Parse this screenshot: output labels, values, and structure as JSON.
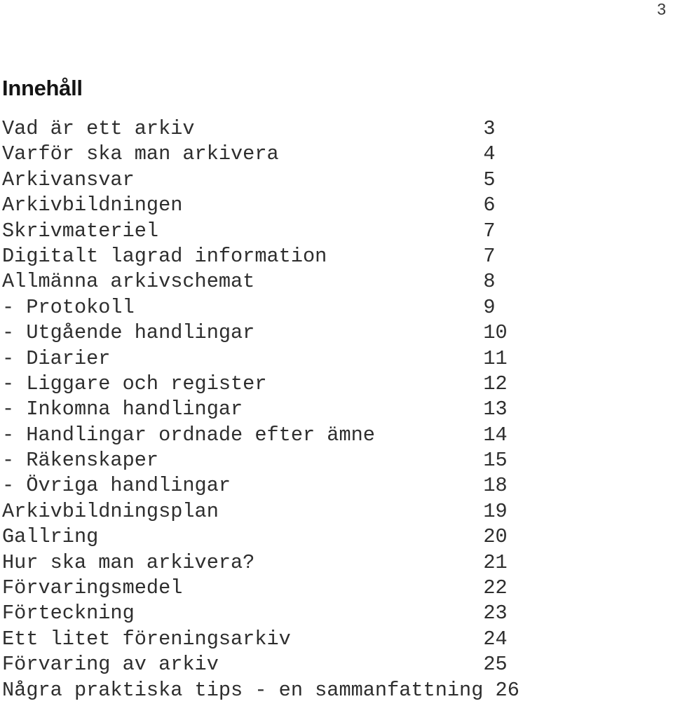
{
  "folio": {
    "page_number": "3"
  },
  "heading": {
    "title": "Innehåll"
  },
  "toc": {
    "column_width_chars": 40,
    "entries": [
      {
        "label": "Vad är ett arkiv",
        "page": "3"
      },
      {
        "label": "Varför ska man arkivera",
        "page": "4"
      },
      {
        "label": "Arkivansvar",
        "page": "5"
      },
      {
        "label": "Arkivbildningen",
        "page": "6"
      },
      {
        "label": "Skrivmateriel",
        "page": "7"
      },
      {
        "label": "Digitalt lagrad information",
        "page": "7"
      },
      {
        "label": "Allmänna arkivschemat",
        "page": "8"
      },
      {
        "label": "- Protokoll",
        "page": "9"
      },
      {
        "label": "- Utgående handlingar",
        "page": "10"
      },
      {
        "label": "- Diarier",
        "page": "11"
      },
      {
        "label": "- Liggare och register",
        "page": "12"
      },
      {
        "label": "- Inkomna handlingar",
        "page": "13"
      },
      {
        "label": "- Handlingar ordnade efter ämne",
        "page": "14"
      },
      {
        "label": "- Räkenskaper",
        "page": "15"
      },
      {
        "label": "- Övriga handlingar",
        "page": "18"
      },
      {
        "label": "Arkivbildningsplan",
        "page": "19"
      },
      {
        "label": "Gallring",
        "page": "20"
      },
      {
        "label": "Hur ska man arkivera?",
        "page": "21"
      },
      {
        "label": "Förvaringsmedel",
        "page": "22"
      },
      {
        "label": "Förteckning",
        "page": "23"
      },
      {
        "label": "Ett litet föreningsarkiv",
        "page": "24"
      },
      {
        "label": "Förvaring av arkiv",
        "page": "25"
      },
      {
        "label": "Några praktiska tips - en sammanfattning",
        "page": "26"
      }
    ]
  }
}
